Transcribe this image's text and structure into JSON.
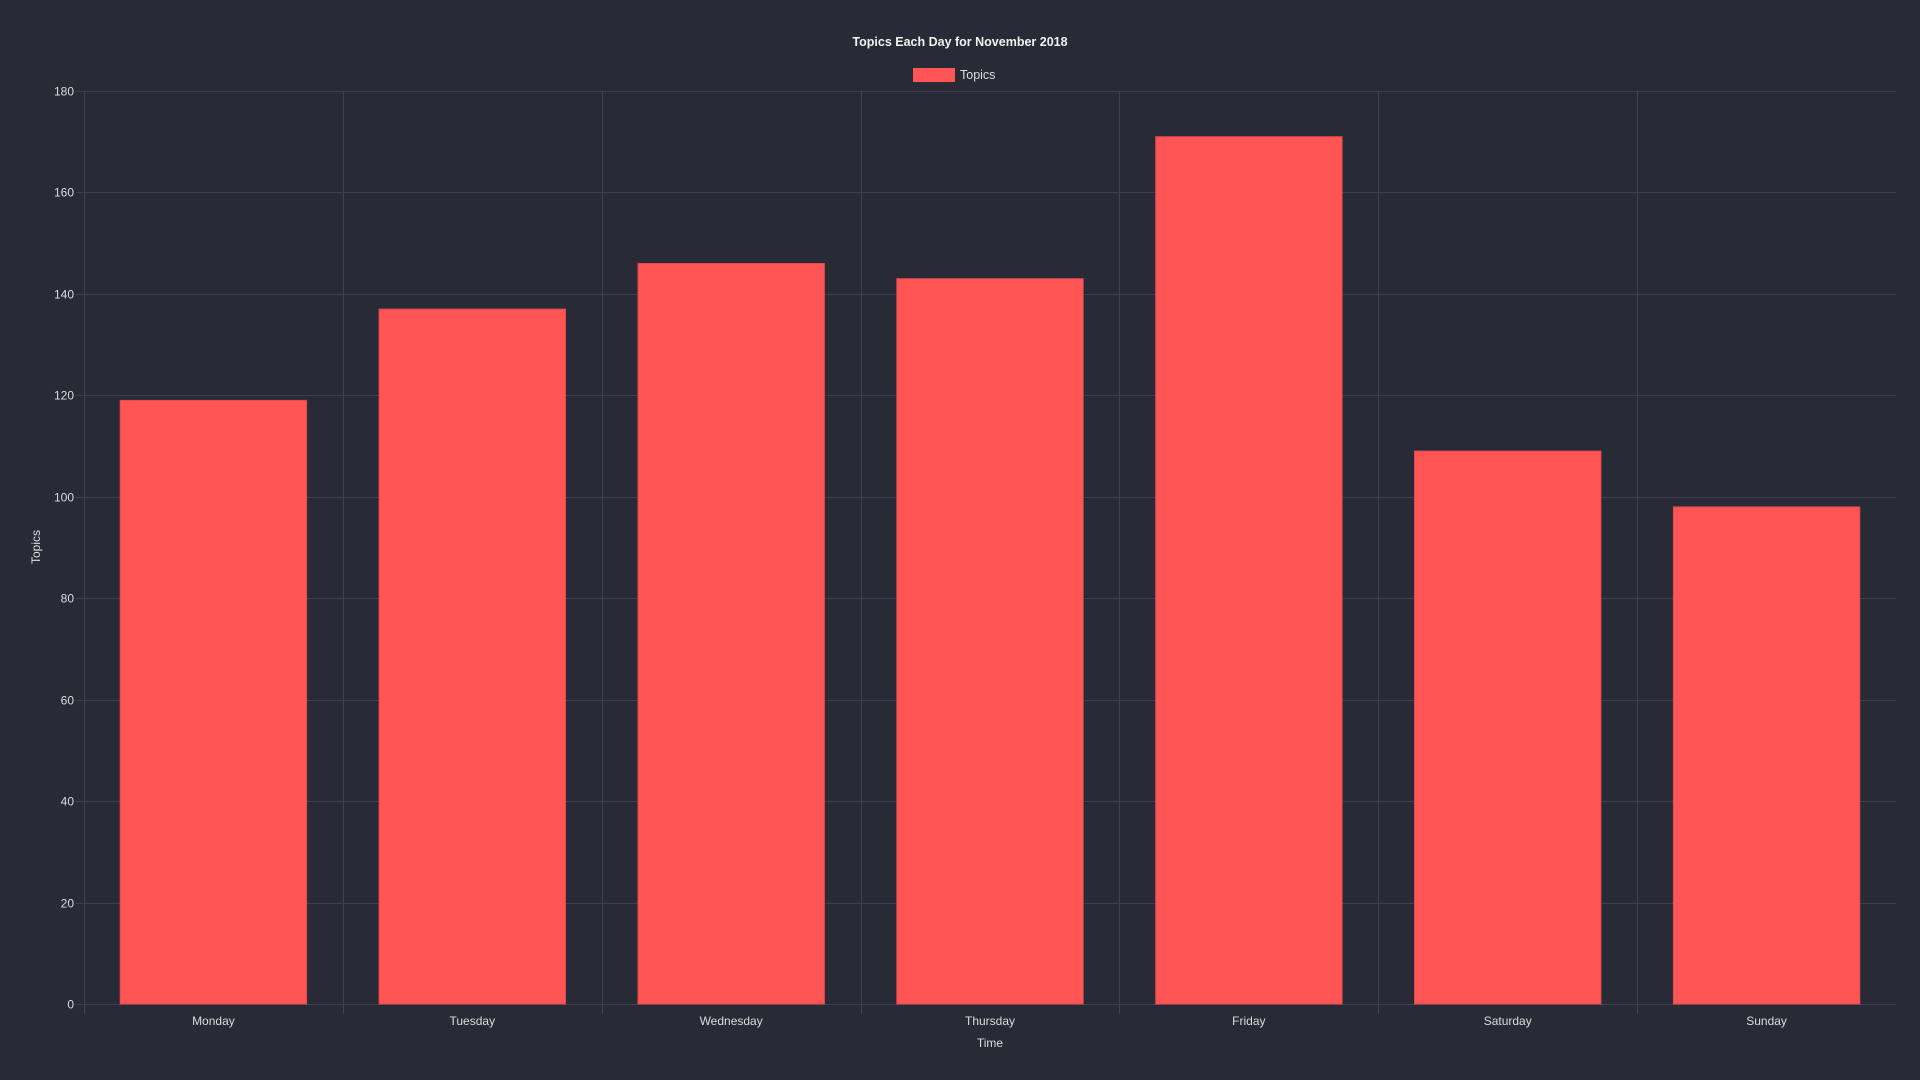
{
  "chart_data": {
    "type": "bar",
    "title": "Topics Each Day for November 2018",
    "categories": [
      "Monday",
      "Tuesday",
      "Wednesday",
      "Thursday",
      "Friday",
      "Saturday",
      "Sunday"
    ],
    "series": [
      {
        "name": "Topics",
        "values": [
          119,
          137,
          146,
          143,
          171,
          109,
          98
        ],
        "color": "#ff5555"
      }
    ],
    "xlabel": "Time",
    "ylabel": "Topics",
    "ylim": [
      0,
      180
    ],
    "yticks": [
      0,
      20,
      40,
      60,
      80,
      100,
      120,
      140,
      160,
      180
    ],
    "grid": true,
    "legend": {
      "position": "top-center",
      "entries": [
        "Topics"
      ]
    }
  },
  "colors": {
    "background": "#282a36",
    "grid": "#3f4152",
    "text": "#dcdcdc"
  }
}
